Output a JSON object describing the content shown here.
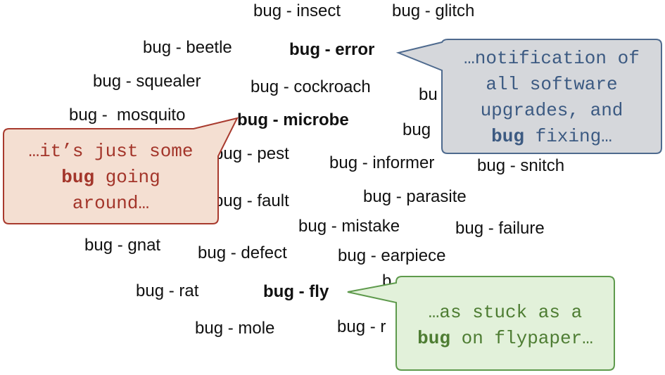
{
  "words": [
    {
      "text": "bug - insect"
    },
    {
      "text": "bug - glitch"
    },
    {
      "text": "bug - beetle"
    },
    {
      "text": "bug - error",
      "bold": true
    },
    {
      "text": "bug - squealer"
    },
    {
      "text": "bug - cockroach"
    },
    {
      "text": "bug -  mosquito"
    },
    {
      "text": "bug - microbe",
      "bold": true
    },
    {
      "text": "bug - pest"
    },
    {
      "text": "bug - informer"
    },
    {
      "text": "bug - snitch"
    },
    {
      "text": "bug - parasite"
    },
    {
      "text": "bug - fault"
    },
    {
      "text": "bug - mistake"
    },
    {
      "text": "bug - failure"
    },
    {
      "text": "bug - gnat"
    },
    {
      "text": "bug - defect"
    },
    {
      "text": "bug - earpiece"
    },
    {
      "text": "bug - rat"
    },
    {
      "text": "bug - fly",
      "bold": true
    },
    {
      "text": "bug - mole"
    },
    {
      "text": "bug - r"
    },
    {
      "text": "b"
    },
    {
      "text": "b"
    },
    {
      "text": "bu"
    },
    {
      "text": "bug"
    }
  ],
  "callouts": {
    "software": {
      "pre": "…notification of\nall software\nupgrades, and\n",
      "bold": "bug",
      "post": " fixing…",
      "colors": {
        "fill": "#d5d7db",
        "border": "#4e6a8e",
        "text": "#3c5a82"
      }
    },
    "illness": {
      "pre": "…it’s just some\n",
      "bold": "bug",
      "post": " going\naround…",
      "colors": {
        "fill": "#f4dfd2",
        "border": "#a83a2e",
        "text": "#a3352a"
      }
    },
    "flypaper": {
      "pre": "…as stuck as a\n",
      "bold": "bug",
      "post": " on flypaper…",
      "colors": {
        "fill": "#e2f1da",
        "border": "#5e9a4c",
        "text": "#4e7d33"
      }
    }
  }
}
